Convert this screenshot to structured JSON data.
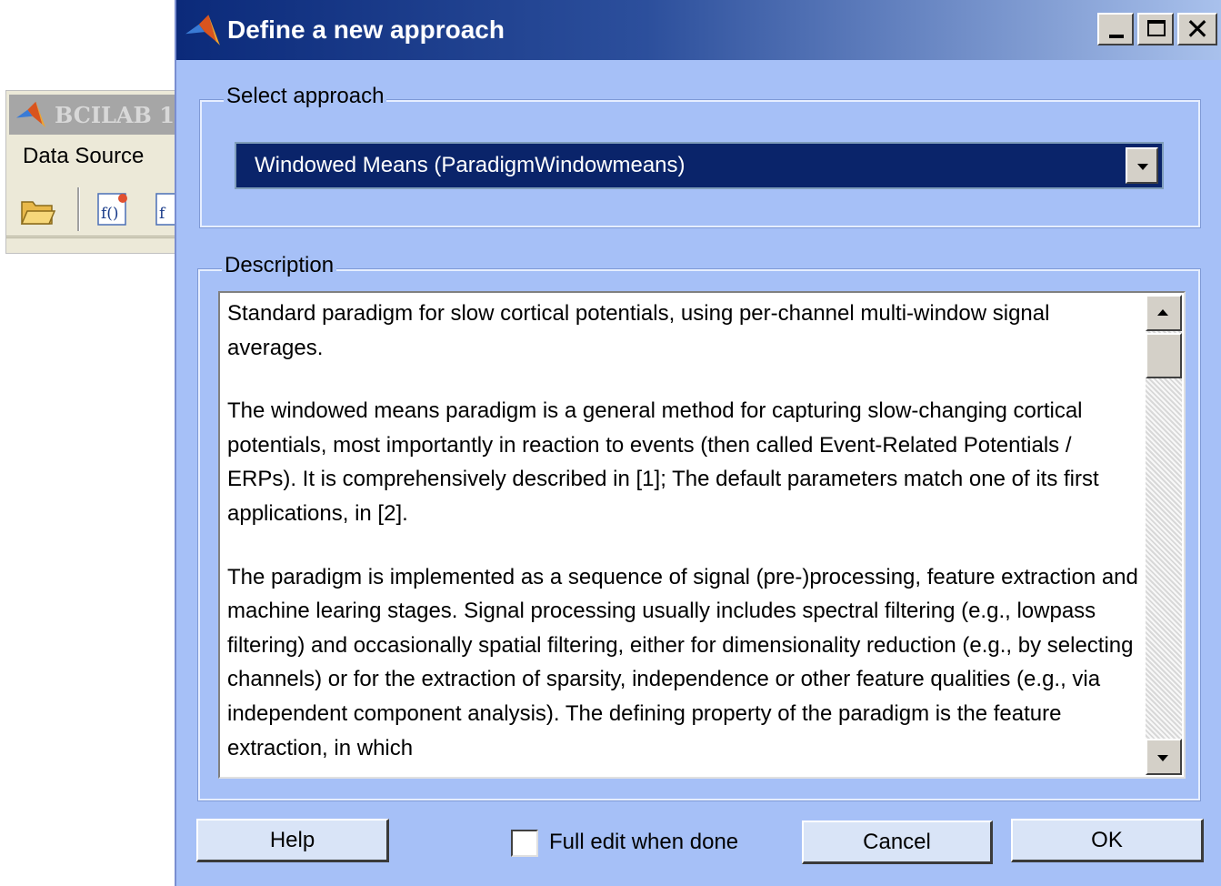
{
  "background_window": {
    "title": "BCILAB 1",
    "menu_item": "Data Source",
    "toolbar_icon_1": "f()",
    "toolbar_icon_2": "f"
  },
  "dialog": {
    "title": "Define a new approach",
    "window_buttons": [
      "minimize-icon",
      "maximize-icon",
      "close-icon"
    ],
    "select_group_label": "Select approach",
    "selected_approach": "Windowed Means (ParadigmWindowmeans)",
    "description_group_label": "Description",
    "description_paragraphs": [
      "Standard paradigm for slow cortical potentials, using per-channel multi-window signal averages.",
      "The windowed means paradigm is a general method for capturing slow-changing cortical potentials, most importantly in reaction to events (then called Event-Related Potentials / ERPs). It is comprehensively described in [1]; The default parameters match one of its first applications, in [2].",
      "The paradigm is implemented as a sequence of signal (pre-)processing, feature extraction and machine learing stages. Signal processing usually includes spectral filtering (e.g., lowpass filtering) and occasionally spatial filtering, either for dimensionality reduction (e.g., by selecting channels) or for the extraction of sparsity, independence or other feature qualities (e.g., via independent component analysis). The defining property of the paradigm is the feature extraction, in which"
    ],
    "buttons": {
      "help": "Help",
      "cancel": "Cancel",
      "ok": "OK"
    },
    "checkbox_label": "Full edit when done",
    "checkbox_checked": false
  },
  "colors": {
    "dialog_bg": "#a6c0f7",
    "title_gradient_start": "#0b2a7a",
    "selection_bg": "#0a246a"
  }
}
